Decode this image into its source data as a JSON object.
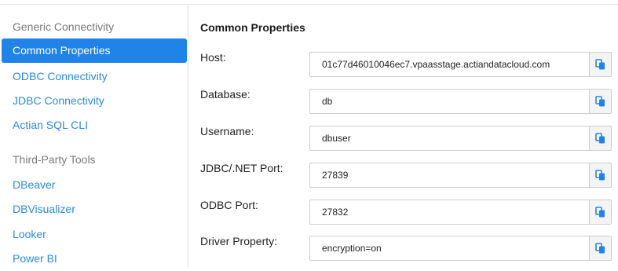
{
  "sidebar": {
    "sections": [
      {
        "label": "Generic Connectivity",
        "items": [
          {
            "label": "Common Properties",
            "active": true
          },
          {
            "label": "ODBC Connectivity",
            "active": false
          },
          {
            "label": "JDBC Connectivity",
            "active": false
          },
          {
            "label": "Actian SQL CLI",
            "active": false
          }
        ]
      },
      {
        "label": "Third-Party Tools",
        "items": [
          {
            "label": "DBeaver",
            "active": false
          },
          {
            "label": "DBVisualizer",
            "active": false
          },
          {
            "label": "Looker",
            "active": false
          },
          {
            "label": "Power BI",
            "active": false
          }
        ]
      }
    ]
  },
  "main": {
    "title": "Common Properties",
    "properties": [
      {
        "label": "Host:",
        "value": "01c77d46010046ec7.vpaasstage.actiandatacloud.com"
      },
      {
        "label": "Database:",
        "value": "db"
      },
      {
        "label": "Username:",
        "value": "dbuser"
      },
      {
        "label": "JDBC/.NET Port:",
        "value": "27839"
      },
      {
        "label": "ODBC Port:",
        "value": "27832"
      },
      {
        "label": "Driver Property:",
        "value": "encryption=on"
      }
    ]
  },
  "colors": {
    "accent": "#1f83e8",
    "link": "#2a8ae0",
    "copy_icon": "#1f83e8"
  },
  "icons": {
    "copy": "copy-icon"
  }
}
